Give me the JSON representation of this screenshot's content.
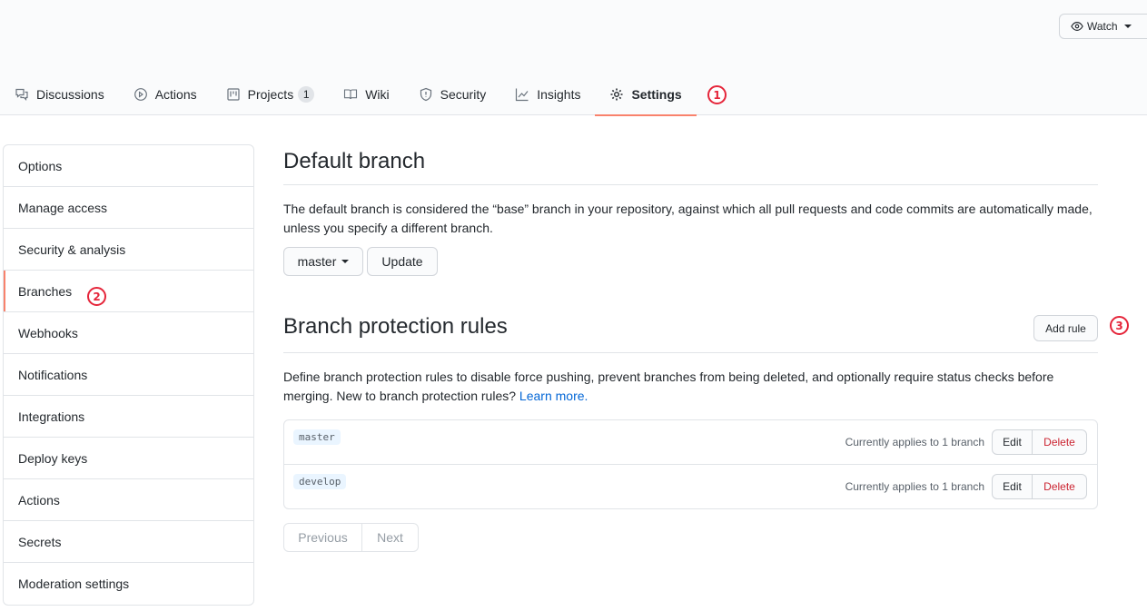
{
  "header": {
    "watch_label": "Watch"
  },
  "tabs": [
    {
      "label": "Discussions",
      "icon": "comment-discussion-icon"
    },
    {
      "label": "Actions",
      "icon": "play-icon"
    },
    {
      "label": "Projects",
      "icon": "project-icon",
      "count": "1"
    },
    {
      "label": "Wiki",
      "icon": "book-icon"
    },
    {
      "label": "Security",
      "icon": "shield-icon"
    },
    {
      "label": "Insights",
      "icon": "graph-icon"
    },
    {
      "label": "Settings",
      "icon": "gear-icon",
      "selected": true
    }
  ],
  "markers": [
    "1",
    "2",
    "3"
  ],
  "sidebar": {
    "items": [
      {
        "label": "Options"
      },
      {
        "label": "Manage access"
      },
      {
        "label": "Security & analysis"
      },
      {
        "label": "Branches",
        "selected": true
      },
      {
        "label": "Webhooks"
      },
      {
        "label": "Notifications"
      },
      {
        "label": "Integrations"
      },
      {
        "label": "Deploy keys"
      },
      {
        "label": "Actions"
      },
      {
        "label": "Secrets"
      },
      {
        "label": "Moderation settings"
      }
    ]
  },
  "default_branch": {
    "title": "Default branch",
    "description": "The default branch is considered the “base” branch in your repository, against which all pull requests and code commits are automatically made, unless you specify a different branch.",
    "selected_branch": "master",
    "update_label": "Update"
  },
  "protection": {
    "title": "Branch protection rules",
    "add_rule_label": "Add rule",
    "description": "Define branch protection rules to disable force pushing, prevent branches from being deleted, and optionally require status checks before merging. New to branch protection rules?",
    "learn_more": "Learn more.",
    "rules": [
      {
        "name": "master",
        "applies": "Currently applies to 1 branch",
        "edit": "Edit",
        "delete": "Delete"
      },
      {
        "name": "develop",
        "applies": "Currently applies to 1 branch",
        "edit": "Edit",
        "delete": "Delete"
      }
    ]
  },
  "pagination": {
    "previous": "Previous",
    "next": "Next"
  },
  "colors": {
    "accent": "#f9826c",
    "marker": "#e5253a",
    "link": "#0366d6",
    "danger": "#cb2431"
  }
}
